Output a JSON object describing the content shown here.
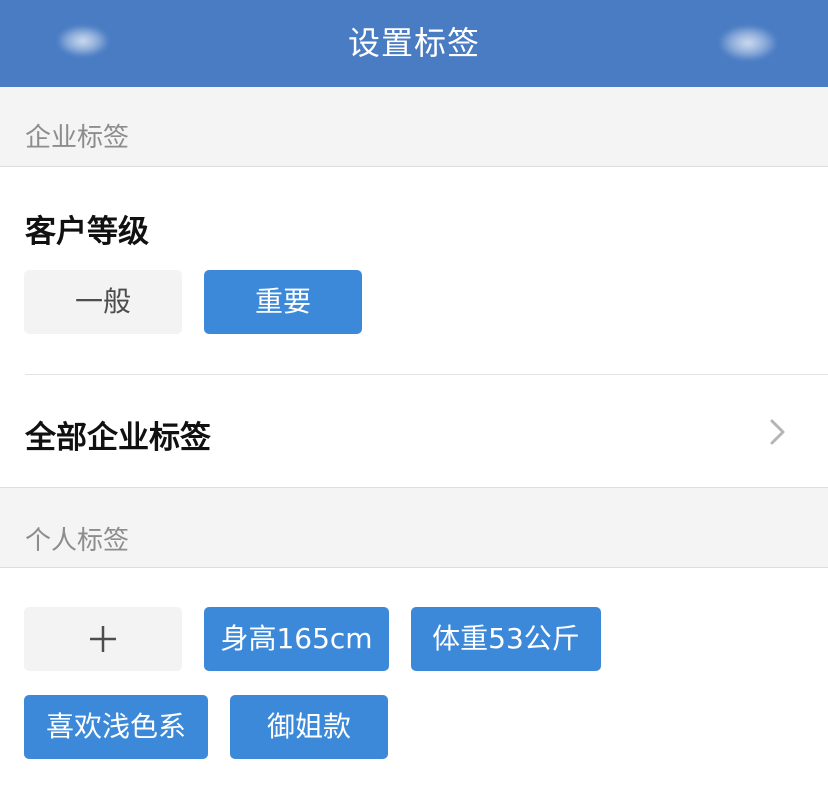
{
  "header": {
    "title": "设置标签"
  },
  "enterprise_tags": {
    "section_label": "企业标签",
    "group_title": "客户等级",
    "options": [
      {
        "label": "一般",
        "selected": false
      },
      {
        "label": "重要",
        "selected": true
      }
    ],
    "all_tags_label": "全部企业标签"
  },
  "personal_tags": {
    "section_label": "个人标签",
    "add_symbol": "+",
    "tags": [
      {
        "label": "身高165cm"
      },
      {
        "label": "体重53公斤"
      },
      {
        "label": "喜欢浅色系"
      },
      {
        "label": "御姐款"
      }
    ]
  },
  "colors": {
    "header_bg": "#4a7cc4",
    "selected_chip": "#3d89d9",
    "unselected_chip": "#f3f3f3",
    "section_bg": "#f4f4f4"
  }
}
